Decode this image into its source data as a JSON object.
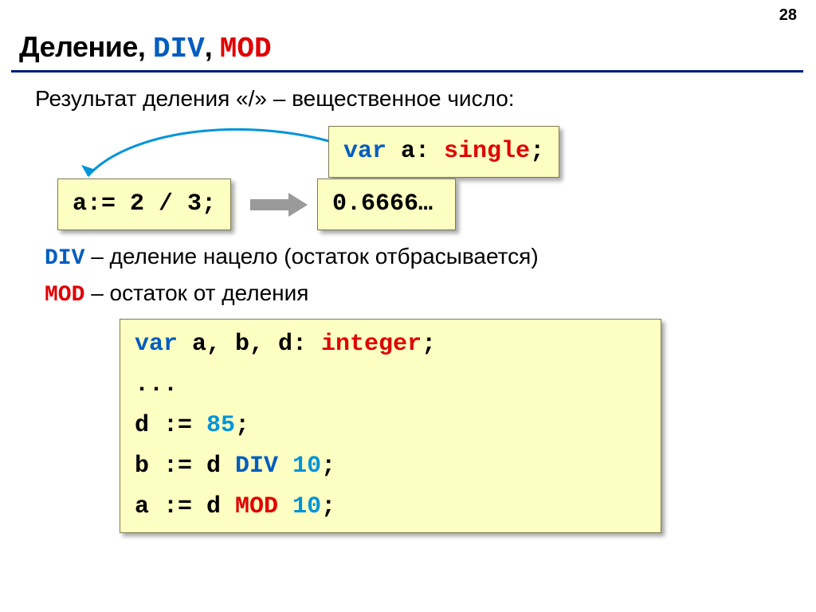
{
  "page_number": "28",
  "title": {
    "t1": "Деление",
    "comma1": ", ",
    "div": "DIV",
    "comma2": ", ",
    "mod": "MOD"
  },
  "subtitle": "Результат деления «/» – вещественное число:",
  "box_var_a": {
    "kw": "var",
    "rest": " a: ",
    "type": "single",
    "semi": ";"
  },
  "box_assign": "a:= 2 / 3;",
  "box_result": "0.6666…",
  "def": {
    "div_kw": "DIV",
    "div_txt": " – деление нацело (остаток отбрасывается)",
    "mod_kw": "MOD",
    "mod_txt": " – остаток от деления"
  },
  "big": {
    "l1": {
      "kw": "var",
      "mid": " a, b, d: ",
      "type": "integer",
      "end": ";"
    },
    "l2": "...",
    "l3": {
      "a": "d := ",
      "n": "85",
      "e": ";"
    },
    "l4": {
      "a": "b := d ",
      "op": "DIV",
      "sp": " ",
      "n": "10",
      "e": ";"
    },
    "l5": {
      "a": "a := d ",
      "op": "MOD",
      "sp": " ",
      "n": "10",
      "e": ";"
    }
  }
}
